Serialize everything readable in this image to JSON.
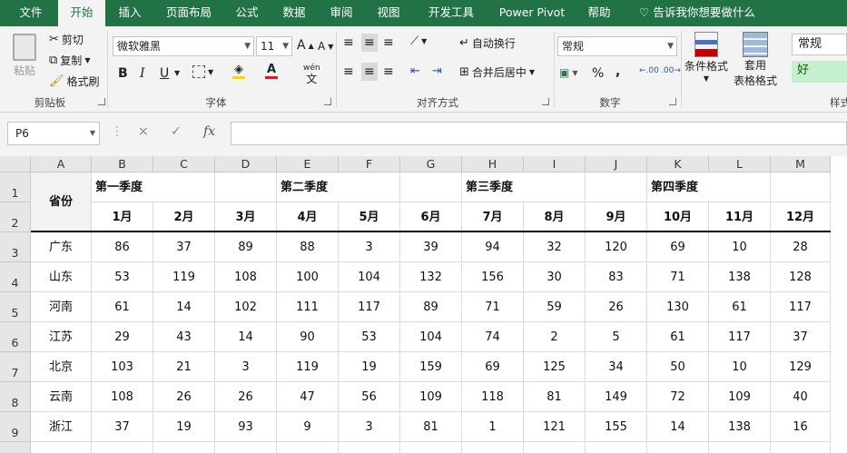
{
  "tabs": [
    "文件",
    "开始",
    "插入",
    "页面布局",
    "公式",
    "数据",
    "审阅",
    "视图",
    "开发工具",
    "Power Pivot",
    "帮助"
  ],
  "tell_me": "告诉我你想要做什么",
  "clipboard": {
    "paste": "粘贴",
    "cut": "剪切",
    "copy": "复制",
    "format_painter": "格式刷",
    "label": "剪贴板"
  },
  "font": {
    "name": "微软雅黑",
    "size": "11",
    "bold": "B",
    "italic": "I",
    "underline": "U",
    "grow": "A",
    "shrink": "A",
    "label": "字体",
    "font_color": "#e81123",
    "fill_color": "#ffd700",
    "phonetic": "wén"
  },
  "alignment": {
    "wrap": "自动换行",
    "merge": "合并后居中",
    "label": "对齐方式"
  },
  "number": {
    "format": "常规",
    "percent": "%",
    "comma": ",",
    "label": "数字"
  },
  "styles": {
    "conditional": "条件格式",
    "table_format_1": "套用",
    "table_format_2": "表格格式",
    "style_normal": "常规",
    "style_good": "好",
    "label": "样式"
  },
  "formula_bar": {
    "name_box": "P6",
    "fx": "fx",
    "cancel": "×",
    "enter": "✓",
    "value": ""
  },
  "columns": [
    "A",
    "B",
    "C",
    "D",
    "E",
    "F",
    "G",
    "H",
    "I",
    "J",
    "K",
    "L",
    "M"
  ],
  "rows": [
    "1",
    "2",
    "3",
    "4",
    "5",
    "6",
    "7",
    "8",
    "9"
  ],
  "sheet": {
    "province_header": "省份",
    "quarters": [
      "第一季度",
      "第二季度",
      "第三季度",
      "第四季度"
    ],
    "months": [
      "1月",
      "2月",
      "3月",
      "4月",
      "5月",
      "6月",
      "7月",
      "8月",
      "9月",
      "10月",
      "11月",
      "12月"
    ],
    "data": [
      {
        "province": "广东",
        "values": [
          86,
          37,
          89,
          88,
          3,
          39,
          94,
          32,
          120,
          69,
          10,
          28
        ]
      },
      {
        "province": "山东",
        "values": [
          53,
          119,
          108,
          100,
          104,
          132,
          156,
          30,
          83,
          71,
          138,
          128
        ]
      },
      {
        "province": "河南",
        "values": [
          61,
          14,
          102,
          111,
          117,
          89,
          71,
          59,
          26,
          130,
          61,
          117
        ]
      },
      {
        "province": "江苏",
        "values": [
          29,
          43,
          14,
          90,
          53,
          104,
          74,
          2,
          5,
          61,
          117,
          37
        ]
      },
      {
        "province": "北京",
        "values": [
          103,
          21,
          3,
          119,
          19,
          159,
          69,
          125,
          34,
          50,
          10,
          129
        ]
      },
      {
        "province": "云南",
        "values": [
          108,
          26,
          26,
          47,
          56,
          109,
          118,
          81,
          149,
          72,
          109,
          40
        ]
      },
      {
        "province": "浙江",
        "values": [
          37,
          19,
          93,
          9,
          3,
          81,
          1,
          121,
          155,
          14,
          138,
          16
        ]
      }
    ]
  }
}
